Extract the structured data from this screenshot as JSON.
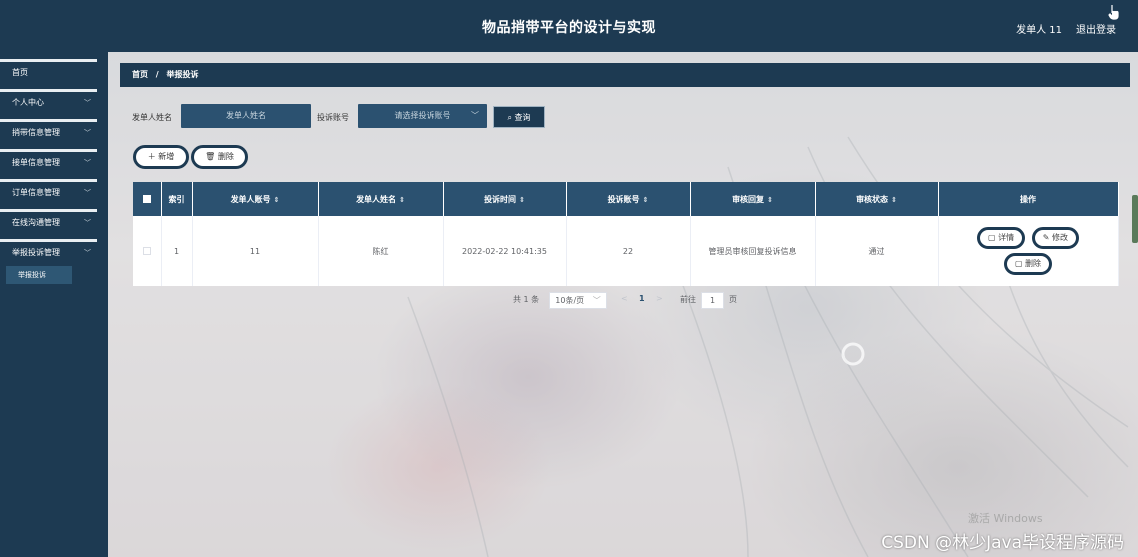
{
  "header": {
    "title": "物品捎带平台的设计与实现",
    "user": "发单人 11",
    "logout": "退出登录"
  },
  "sidebar": {
    "items": [
      {
        "label": "首页",
        "has_children": false
      },
      {
        "label": "个人中心",
        "has_children": true
      },
      {
        "label": "捎带信息管理",
        "has_children": true
      },
      {
        "label": "接单信息管理",
        "has_children": true
      },
      {
        "label": "订单信息管理",
        "has_children": true
      },
      {
        "label": "在线沟通管理",
        "has_children": true
      },
      {
        "label": "举报投诉管理",
        "has_children": true
      }
    ],
    "submenu": "举报投诉"
  },
  "breadcrumb": {
    "home": "首页",
    "separator": "/",
    "current": "举报投诉"
  },
  "search": {
    "name_label": "发单人姓名",
    "name_placeholder": "发单人姓名",
    "account_label": "投诉账号",
    "account_placeholder": "请选择投诉账号",
    "query_label": "查询"
  },
  "actions": {
    "add_label": "新增",
    "delete_label": "删除"
  },
  "table": {
    "columns": [
      "索引",
      "发单人账号",
      "发单人姓名",
      "投诉时间",
      "投诉账号",
      "审核回复",
      "审核状态",
      "操作"
    ],
    "rows": [
      {
        "index": "1",
        "account": "11",
        "name": "陈红",
        "time": "2022-02-22 10:41:35",
        "complaint_account": "22",
        "reply": "管理员审核回复投诉信息",
        "status": "通过"
      }
    ],
    "row_actions": {
      "detail": "详情",
      "edit": "修改",
      "delete": "删除"
    }
  },
  "pagination": {
    "total": "共 1 条",
    "page_size": "10条/页",
    "current_page": "1",
    "goto_label": "前往",
    "goto_value": "1",
    "page_unit": "页"
  },
  "watermarks": {
    "windows": "激活 Windows",
    "csdn": "CSDN @林少Java毕设程序源码"
  },
  "colors": {
    "primary": "#1d3a52",
    "table_header": "#2b5170"
  }
}
